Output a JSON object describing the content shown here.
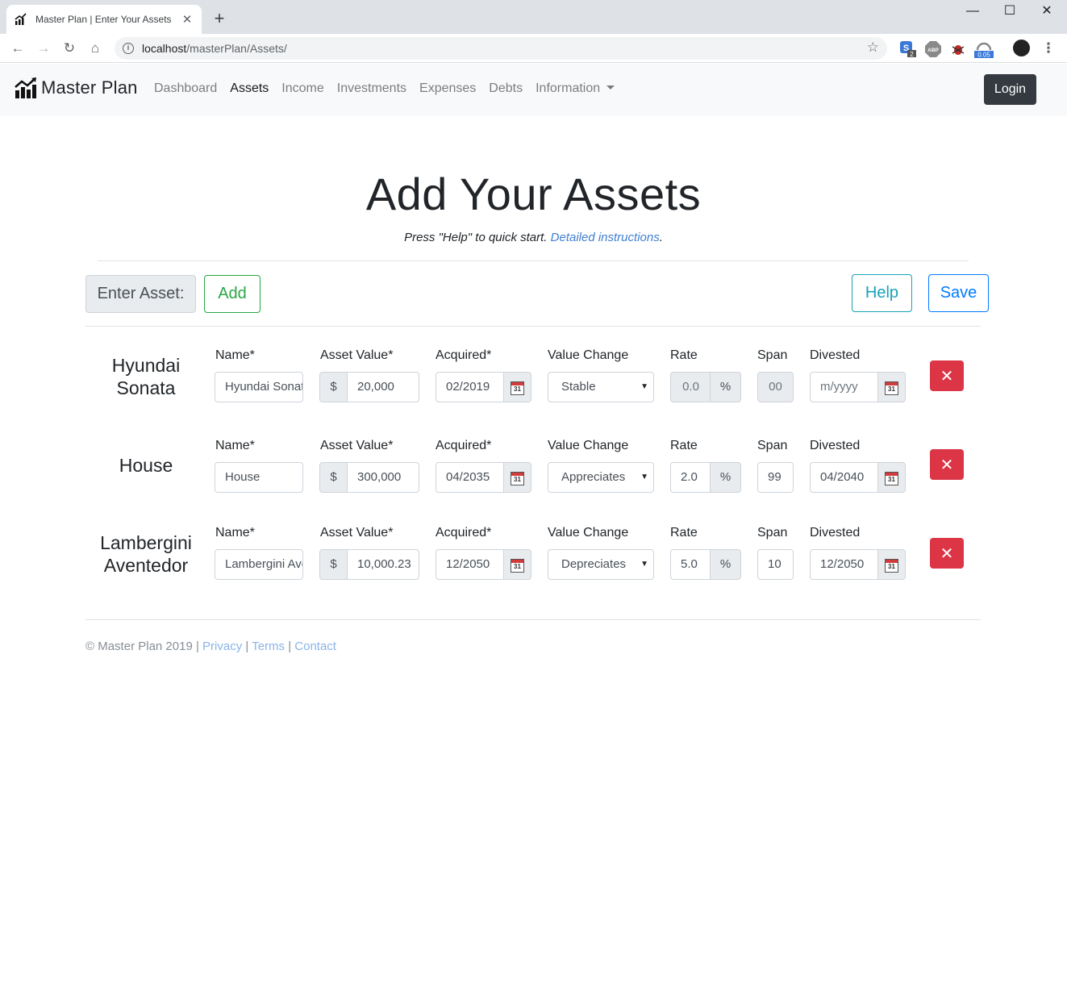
{
  "browser": {
    "tab_title": "Master Plan | Enter Your Assets",
    "tab_close": "✕",
    "new_tab": "+",
    "url_host": "localhost",
    "url_path": "/masterPlan/Assets/",
    "window_controls": {
      "minimize": "—",
      "maximize": "☐",
      "close": "✕"
    },
    "extensions": [
      {
        "name": "s-ext-icon",
        "badge": "2"
      },
      {
        "name": "abp-icon",
        "label": "ABP"
      },
      {
        "name": "bug-icon"
      },
      {
        "name": "speed-ext-icon",
        "badge": "0.05"
      }
    ]
  },
  "navbar": {
    "brand": "Master Plan",
    "links": [
      "Dashboard",
      "Assets",
      "Income",
      "Investments",
      "Expenses",
      "Debts",
      "Information"
    ],
    "active": "Assets",
    "login": "Login"
  },
  "header": {
    "title": "Add Your Assets",
    "lead_prefix": "Press \"Help\" to quick start. ",
    "lead_link": "Detailed instructions",
    "lead_suffix": "."
  },
  "toolbar": {
    "enter_label": "Enter Asset:",
    "add": "Add",
    "help": "Help",
    "save": "Save"
  },
  "field_labels": {
    "name": "Name*",
    "asset_value": "Asset Value*",
    "acquired": "Acquired*",
    "value_change": "Value Change",
    "rate": "Rate",
    "span": "Span",
    "divested": "Divested",
    "currency": "$",
    "percent": "%",
    "calendar_day": "31",
    "delete": "✕",
    "select_arrow": "▼"
  },
  "assets": [
    {
      "title_line1": "Hyundai",
      "title_line2": "Sonata",
      "name": "Hyundai Sonata",
      "value": "20,000",
      "acquired": "02/2019",
      "value_change": "Stable",
      "rate": "0.0",
      "span": "00",
      "divested": "",
      "divested_placeholder": "m/yyyy"
    },
    {
      "title_line1": "House",
      "title_line2": "",
      "name": "House",
      "value": "300,000",
      "acquired": "04/2035",
      "value_change": "Appreciates",
      "rate": "2.0",
      "span": "99",
      "divested": "04/2040",
      "divested_placeholder": "m/yyyy"
    },
    {
      "title_line1": "Lambergini",
      "title_line2": "Aventedor",
      "name": "Lambergini Aventedor",
      "value": "10,000.23",
      "acquired": "12/2050",
      "value_change": "Depreciates",
      "rate": "5.0",
      "span": "10",
      "divested": "12/2050",
      "divested_placeholder": "m/yyyy"
    }
  ],
  "footer": {
    "copyright": "© Master Plan 2019 | ",
    "privacy": "Privacy",
    "sep": " | ",
    "terms": "Terms",
    "contact": "Contact"
  }
}
